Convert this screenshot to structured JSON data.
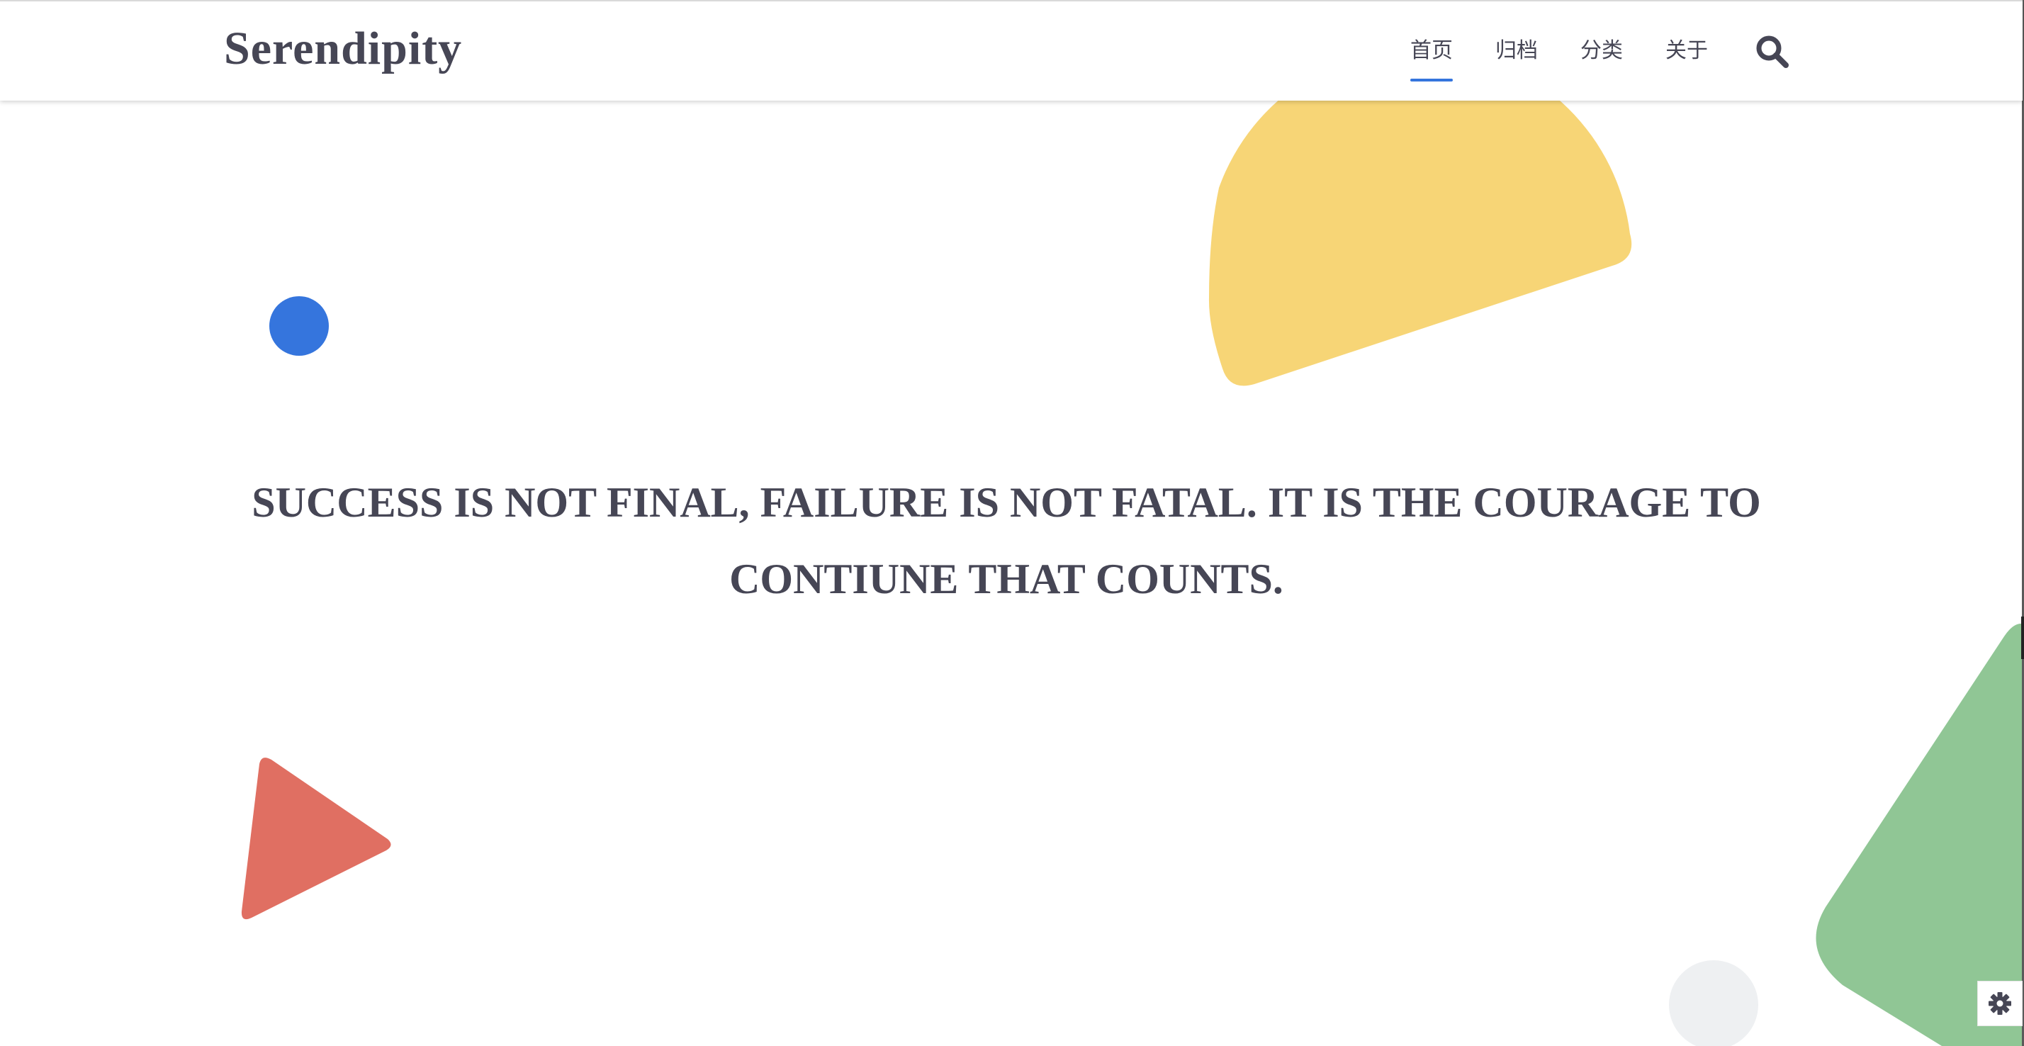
{
  "header": {
    "brand": "Serendipity",
    "nav": [
      {
        "label": "首页",
        "active": true
      },
      {
        "label": "归档",
        "active": false
      },
      {
        "label": "分类",
        "active": false
      },
      {
        "label": "关于",
        "active": false
      }
    ],
    "search_icon": "search-icon"
  },
  "hero": {
    "quote_line1": "SUCCESS IS NOT FINAL, FAILURE IS NOT FATAL. IT IS THE COURAGE TO",
    "quote_line2": "CONTIUNE THAT COUNTS."
  },
  "decorations": {
    "yellow_half_circle": "#f7d576",
    "blue_dot": "#3575dd",
    "red_triangle": "#e06f62",
    "green_shape": "#90c695",
    "grey_circle": "#eef0f2"
  },
  "settings_icon": "gear-icon",
  "colors": {
    "text": "#464655",
    "accent": "#3575dd"
  }
}
